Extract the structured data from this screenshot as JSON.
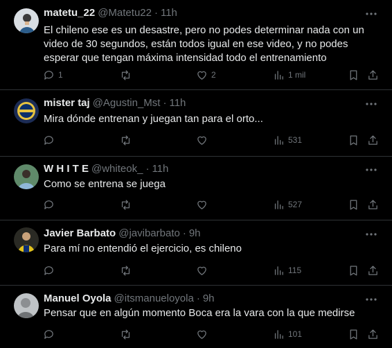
{
  "tweets": [
    {
      "name": "matetu_22",
      "handle": "@Matetu22",
      "time": "11h",
      "text": "El chileno ese es un desastre, pero no podes determinar nada con un video de 30 segundos, están todos igual en ese video, y no podes esperar que tengan máxima intensidad todo el entrenamiento",
      "replies": "1",
      "retweets": "",
      "likes": "2",
      "views": "1 mil"
    },
    {
      "name": "mister taj",
      "handle": "@Agustin_Mst",
      "time": "11h",
      "text": "Mira dónde entrenan y juegan tan para el orto...",
      "replies": "",
      "retweets": "",
      "likes": "",
      "views": "531"
    },
    {
      "name": "W H I T E",
      "handle": "@whiteok_",
      "time": "11h",
      "text": "Como se entrena se juega",
      "replies": "",
      "retweets": "",
      "likes": "",
      "views": "527"
    },
    {
      "name": "Javier Barbato",
      "handle": "@javibarbato",
      "time": "9h",
      "text": "Para mí no entendió el ejercicio, es chileno",
      "replies": "",
      "retweets": "",
      "likes": "",
      "views": "115"
    },
    {
      "name": "Manuel Oyola",
      "handle": "@itsmanueloyola",
      "time": "9h",
      "text": "Pensar que en algún momento Boca era la vara con la que medirse",
      "replies": "",
      "retweets": "",
      "likes": "",
      "views": "101"
    }
  ],
  "icons": {
    "reply": "reply-icon",
    "retweet": "retweet-icon",
    "like": "heart-icon",
    "views": "views-chart-icon",
    "bookmark": "bookmark-icon",
    "share": "share-icon",
    "more": "more-icon"
  },
  "colors": {
    "background": "#000000",
    "text": "#e7e9ea",
    "muted": "#71767b",
    "divider": "#2f3336"
  }
}
